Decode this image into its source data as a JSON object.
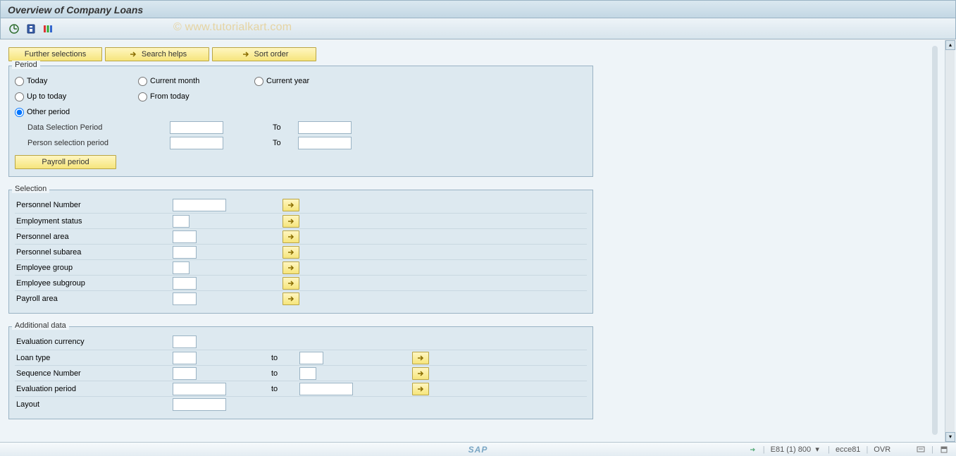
{
  "title": "Overview of Company Loans",
  "watermark": "© www.tutorialkart.com",
  "toolbar_buttons": {
    "further_selections": "Further selections",
    "search_helps": "Search helps",
    "sort_order": "Sort order"
  },
  "group_period": {
    "title": "Period",
    "radios": {
      "today": "Today",
      "current_month": "Current month",
      "current_year": "Current year",
      "up_to_today": "Up to today",
      "from_today": "From today",
      "other_period": "Other period"
    },
    "selected": "other_period",
    "fields": {
      "data_selection_period": {
        "label": "Data Selection Period",
        "from": "",
        "to_label": "To",
        "to": ""
      },
      "person_selection_period": {
        "label": "Person selection period",
        "from": "",
        "to_label": "To",
        "to": ""
      }
    },
    "payroll_period_btn": "Payroll period"
  },
  "group_selection": {
    "title": "Selection",
    "rows": [
      {
        "key": "personnel_number",
        "label": "Personnel Number",
        "width": "w76",
        "value": ""
      },
      {
        "key": "employment_status",
        "label": "Employment status",
        "width": "w24",
        "value": ""
      },
      {
        "key": "personnel_area",
        "label": "Personnel area",
        "width": "w34",
        "value": ""
      },
      {
        "key": "personnel_subarea",
        "label": "Personnel subarea",
        "width": "w34",
        "value": ""
      },
      {
        "key": "employee_group",
        "label": "Employee group",
        "width": "w24",
        "value": ""
      },
      {
        "key": "employee_subgroup",
        "label": "Employee subgroup",
        "width": "w34",
        "value": ""
      },
      {
        "key": "payroll_area",
        "label": "Payroll area",
        "width": "w34",
        "value": ""
      }
    ]
  },
  "group_additional": {
    "title": "Additional data",
    "rows": [
      {
        "key": "evaluation_currency",
        "label": "Evaluation currency",
        "from_width": "w34",
        "to": false,
        "multi": false,
        "from": ""
      },
      {
        "key": "loan_type",
        "label": "Loan type",
        "from_width": "w34",
        "to": true,
        "to_label": "to",
        "to_width": "w34",
        "multi": true,
        "from": "",
        "to_value": ""
      },
      {
        "key": "sequence_number",
        "label": "Sequence Number",
        "from_width": "w34",
        "to": true,
        "to_label": "to",
        "to_width": "w24",
        "multi": true,
        "from": "",
        "to_value": ""
      },
      {
        "key": "evaluation_period",
        "label": "Evaluation period",
        "from_width": "w76",
        "to": true,
        "to_label": "to",
        "to_width": "w76",
        "multi": true,
        "from": "",
        "to_value": ""
      },
      {
        "key": "layout",
        "label": "Layout",
        "from_width": "w76",
        "to": false,
        "multi": false,
        "from": ""
      }
    ]
  },
  "status": {
    "sap_logo": "SAP",
    "system": "E81 (1) 800",
    "server": "ecce81",
    "mode": "OVR"
  }
}
